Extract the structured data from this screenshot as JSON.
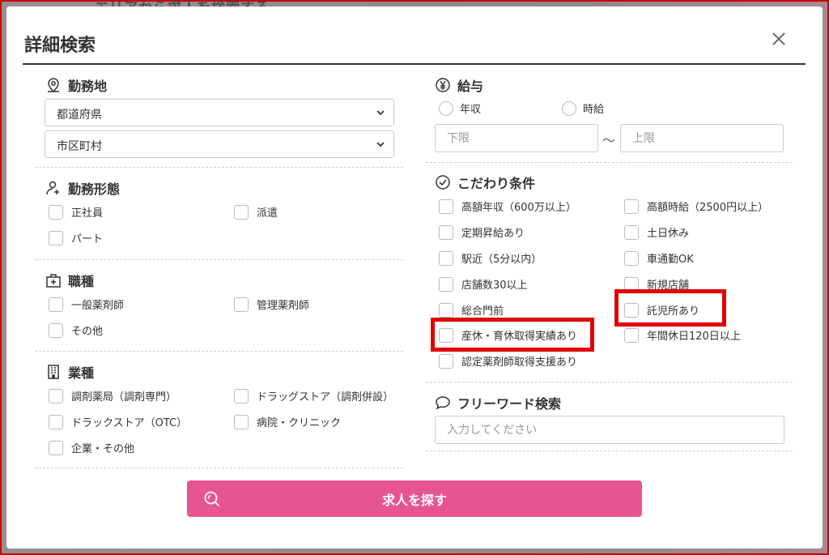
{
  "background": {
    "hint_text": "エリアから求人を検索する"
  },
  "modal": {
    "title": "詳細検索"
  },
  "location": {
    "title": "勤務地",
    "prefecture_select": "都道府県",
    "city_select": "市区町村"
  },
  "employment": {
    "title": "勤務形態",
    "options": [
      "正社員",
      "派遣",
      "パート"
    ]
  },
  "job_type": {
    "title": "職種",
    "options": [
      "一般薬剤師",
      "管理薬剤師",
      "その他"
    ]
  },
  "industry": {
    "title": "業種",
    "options": [
      "調剤薬局（調剤専門）",
      "ドラッグストア（調剤併設）",
      "ドラックストア（OTC）",
      "病院・クリニック",
      "企業・その他"
    ]
  },
  "salary": {
    "title": "給与",
    "radio_annual": "年収",
    "radio_hourly": "時給",
    "min_placeholder": "下限",
    "max_placeholder": "上限",
    "range_sep": "〜"
  },
  "conditions": {
    "title": "こだわり条件",
    "options": [
      "高額年収（600万以上）",
      "高額時給（2500円以上）",
      "定期昇給あり",
      "土日休み",
      "駅近（5分以内）",
      "車通勤OK",
      "店舗数30以上",
      "新規店舗",
      "総合門前",
      "託児所あり",
      "産休・育休取得実績あり",
      "年間休日120日以上",
      "認定薬剤師取得支援あり"
    ]
  },
  "freeword": {
    "title": "フリーワード検索",
    "placeholder": "入力してください"
  },
  "search_button": {
    "label": "求人を探す"
  },
  "colors": {
    "accent": "#e75590",
    "highlight": "#e00000",
    "text": "#333333",
    "border": "#cccccc"
  }
}
